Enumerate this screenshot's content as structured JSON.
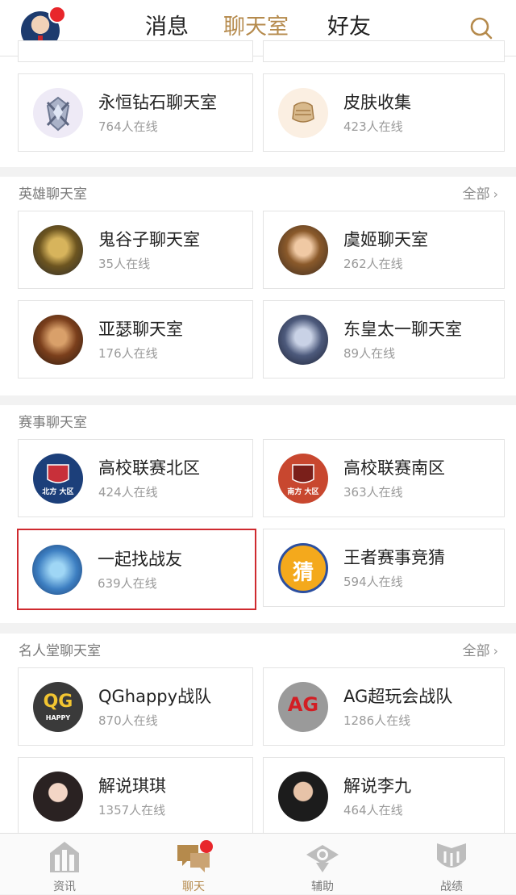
{
  "header": {
    "tabs": [
      "消息",
      "聊天室",
      "好友"
    ],
    "active_tab": 1
  },
  "featured": {
    "cards": [
      {
        "name": "永恒钻石聊天室",
        "count": "764人在线",
        "icon": "diamond-rank-icon"
      },
      {
        "name": "皮肤收集",
        "count": "423人在线",
        "icon": "armor-icon"
      }
    ]
  },
  "hero_section": {
    "title": "英雄聊天室",
    "all_label": "全部",
    "cards": [
      {
        "name": "鬼谷子聊天室",
        "count": "35人在线",
        "icon": "hero-avatar"
      },
      {
        "name": "虞姬聊天室",
        "count": "262人在线",
        "icon": "hero-avatar"
      },
      {
        "name": "亚瑟聊天室",
        "count": "176人在线",
        "icon": "hero-avatar"
      },
      {
        "name": "东皇太一聊天室",
        "count": "89人在线",
        "icon": "hero-avatar"
      }
    ]
  },
  "event_section": {
    "title": "赛事聊天室",
    "cards": [
      {
        "name": "高校联赛北区",
        "count": "424人在线",
        "icon": "north-league-badge"
      },
      {
        "name": "高校联赛南区",
        "count": "363人在线",
        "icon": "south-league-badge"
      },
      {
        "name": "一起找战友",
        "count": "639人在线",
        "icon": "team-logo"
      },
      {
        "name": "王者赛事竞猜",
        "count": "594人在线",
        "icon": "guess-icon"
      }
    ],
    "north_badge_text": "北方 大区",
    "south_badge_text": "南方 大区",
    "guess_glyph": "猜"
  },
  "fame_section": {
    "title": "名人堂聊天室",
    "all_label": "全部",
    "cards": [
      {
        "name": "QGhappy战队",
        "count": "870人在线",
        "icon": "qg-logo"
      },
      {
        "name": "AG超玩会战队",
        "count": "1286人在线",
        "icon": "ag-logo"
      },
      {
        "name": "解说琪琪",
        "count": "1357人在线",
        "icon": "person-avatar"
      },
      {
        "name": "解说李九",
        "count": "464人在线",
        "icon": "person-avatar"
      }
    ],
    "qg_text": "QG",
    "qg_sub": "HAPPY",
    "ag_text": "AG"
  },
  "bottom_nav": [
    {
      "label": "资讯",
      "icon": "news-icon"
    },
    {
      "label": "聊天",
      "icon": "chat-icon"
    },
    {
      "label": "辅助",
      "icon": "assist-icon"
    },
    {
      "label": "战绩",
      "icon": "record-icon"
    }
  ],
  "colors": {
    "accent": "#b58a4c",
    "badge_red": "#e8262b",
    "highlight_border": "#cf2a2f"
  }
}
